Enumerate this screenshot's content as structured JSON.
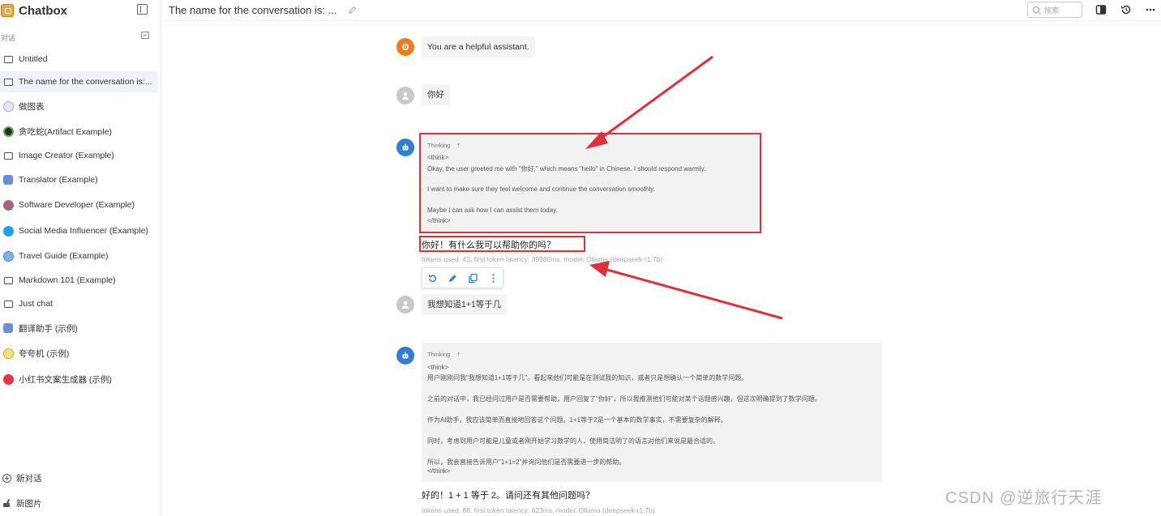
{
  "app": {
    "name": "Chatbox",
    "accent": "#2f7fd9",
    "highlight_color": "#e0313a"
  },
  "sidebar": {
    "section_label": "对话",
    "conversations": [
      {
        "label": "Untitled",
        "icon": "image-icon"
      },
      {
        "label": "The name for the conversation is:...",
        "icon": "chat-icon",
        "active": true
      },
      {
        "label": "做图表",
        "icon": "chart-avatar-icon"
      },
      {
        "label": "贪吃蛇(Artifact Example)",
        "icon": "snake-avatar-icon"
      },
      {
        "label": "Image Creator (Example)",
        "icon": "image-icon"
      },
      {
        "label": "Translator (Example)",
        "icon": "translator-avatar-icon"
      },
      {
        "label": "Software Developer (Example)",
        "icon": "developer-avatar-icon"
      },
      {
        "label": "Social Media Influencer (Example)",
        "icon": "twitter-avatar-icon"
      },
      {
        "label": "Travel Guide (Example)",
        "icon": "travel-avatar-icon"
      },
      {
        "label": "Markdown 101 (Example)",
        "icon": "chat-icon"
      },
      {
        "label": "Just chat",
        "icon": "chat-icon"
      },
      {
        "label": "翻译助手 (示例)",
        "icon": "translator-avatar-icon"
      },
      {
        "label": "夸夸机 (示例)",
        "icon": "praise-avatar-icon"
      },
      {
        "label": "小红书文案生成器 (示例)",
        "icon": "xiaohongshu-avatar-icon"
      }
    ],
    "new_chat": "新对话",
    "new_image": "新图片"
  },
  "header": {
    "title": "The name for the conversation is: ...",
    "search_placeholder": "搜索"
  },
  "messages": {
    "system": "You are a helpful assistant.",
    "user1": "你好",
    "thinking_label": "Thinking",
    "think1": [
      "<think>",
      "Okay, the user greeted me with \"你好,\" which means \"hello\" in Chinese. I should respond warmly.",
      "I want to make sure they feel welcome and continue the conversation smoothly.",
      "Maybe I can ask how I can assist them today.",
      "</think>"
    ],
    "answer1": "你好！有什么我可以帮助你的吗？",
    "meta1": "tokens used: 42, first token latency: 39980ms, model: Ollama (deepseek-r1:7b)",
    "user2": "我想知道1+1等于几",
    "think2": [
      "<think>",
      "用户刚刚问我\"我想知道1+1等于几\"。看起来他们可能是在测试我的知识，或者只是想确认一个简单的数学问题。",
      "之前的对话中，我已经问过用户是否需要帮助，用户回复了\"你好\"，所以我推测他们可能对某个话题感兴趣，但这次明确提到了数学问题。",
      "作为AI助手，我应该简单而直接地回答这个问题。1+1等于2是一个基本的数学事实，不需要复杂的解释。",
      "同时，考虑到用户可能是儿童或者刚开始学习数学的人，使用简洁明了的语言对他们来说是最合适的。",
      "所以，我会直接告诉用户\"1+1=2\"并询问他们是否需要进一步的帮助。",
      "</think>"
    ],
    "answer2": "好的！1 + 1 等于 2。请问还有其他问题吗？",
    "meta2": "tokens used: 86, first token latency: 623ms, model: Ollama (deepseek-r1:7b)"
  },
  "watermark": "CSDN @逆旅行天涯"
}
